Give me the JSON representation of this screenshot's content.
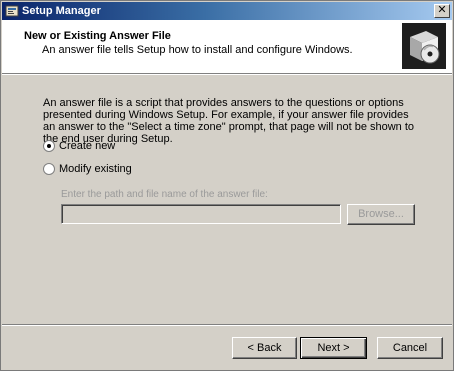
{
  "window": {
    "title": "Setup Manager",
    "close_glyph": "✕"
  },
  "header": {
    "title": "New or Existing Answer File",
    "subtitle": "An answer file tells Setup how to install and configure Windows.",
    "icon": "setup-box-disc-icon"
  },
  "body": {
    "description": "An answer file is a script that provides answers to the questions or options presented during Windows Setup. For example, if your answer file provides an answer to the \"Select a time zone\" prompt, that page will not be shown to the end user during Setup.",
    "options": [
      {
        "label": "Create new",
        "selected": true
      },
      {
        "label": "Modify existing",
        "selected": false
      }
    ],
    "path_label": "Enter the path and file name of the answer file:",
    "path_value": "",
    "browse_label": "Browse..."
  },
  "footer": {
    "back_label": "< Back",
    "next_label": "Next >",
    "cancel_label": "Cancel"
  },
  "colors": {
    "titlebar_start": "#0a246a",
    "titlebar_end": "#a6caf0",
    "dialog_bg": "#d4d0c8",
    "disabled_text": "#9a9a9a"
  }
}
